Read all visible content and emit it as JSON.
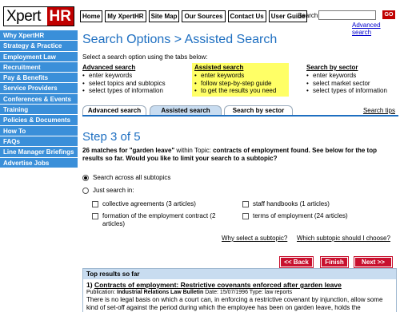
{
  "brand": {
    "xpert": "Xpert",
    "hr": "HR"
  },
  "topnav": [
    "Home",
    "My XpertHR",
    "Site Map",
    "Our Sources",
    "Contact Us",
    "User Guide"
  ],
  "search": {
    "label": "Search",
    "value": "",
    "go_label": "GO",
    "advanced_link": "Advanced search"
  },
  "sidebar": {
    "items": [
      "Why XpertHR",
      "Strategy & Practice",
      "Employment Law",
      "Recruitment",
      "Pay & Benefits",
      "Service Providers",
      "Conferences & Events",
      "Training",
      "Policies & Documents",
      "How To",
      "FAQs",
      "Line Manager Briefings",
      "Advertise Jobs"
    ]
  },
  "main": {
    "title": "Search Options > Assisted Search",
    "instructions": "Select a search option using the tabs below:",
    "options": [
      {
        "heading": "Advanced search",
        "bullets": [
          "enter keywords",
          "select topics and subtopics",
          "select types of information"
        ]
      },
      {
        "heading": "Assisted search",
        "bullets": [
          "enter keywords",
          "follow step-by-step guide",
          "to get the results you need"
        ]
      },
      {
        "heading": "Search by sector",
        "bullets": [
          "enter keywords",
          "select market sector",
          "select types of information"
        ]
      }
    ],
    "tabs": [
      "Advanced search",
      "Assisted search",
      "Search by sector"
    ],
    "search_tips": "Search tips",
    "step_title": "Step 3 of 5",
    "matches": {
      "count_prefix": "26 matches for ",
      "query": "\"garden leave\"",
      "topic_prefix": " within Topic: ",
      "topic": "contracts of employment",
      "rest": " found. See below for the top results so far. Would you like to limit your search to a subtopic?"
    },
    "radio_all": "Search across all subtopics",
    "radio_just": "Just search in:",
    "subtopics": [
      "collective agreements (3 articles)",
      "formation of the employment contract (2 articles)",
      "staff handbooks (1 articles)",
      "terms of employment (24 articles)"
    ],
    "why_link": "Why select a subtopic?",
    "which_link": "Which subtopic should I choose?",
    "buttons": {
      "back": "<< Back",
      "finish": "Finish",
      "next": "Next >>"
    },
    "results": {
      "heading": "Top results so far",
      "items": [
        {
          "number": "1)",
          "title": "Contracts of employment: Restrictive covenants enforced after garden leave",
          "publication_label": "Publication:",
          "publication": "Industrial Relations Law Bulletin",
          "date_label": "Date:",
          "date": "15/07/1996",
          "type_label": "Type:",
          "type": "law reports",
          "snippet": "There is no legal basis on which a court can, in enforcing a restrictive covenant by injunction, allow some kind of set-off against the period during which the employee has been on garden leave, holds the"
        }
      ]
    }
  }
}
